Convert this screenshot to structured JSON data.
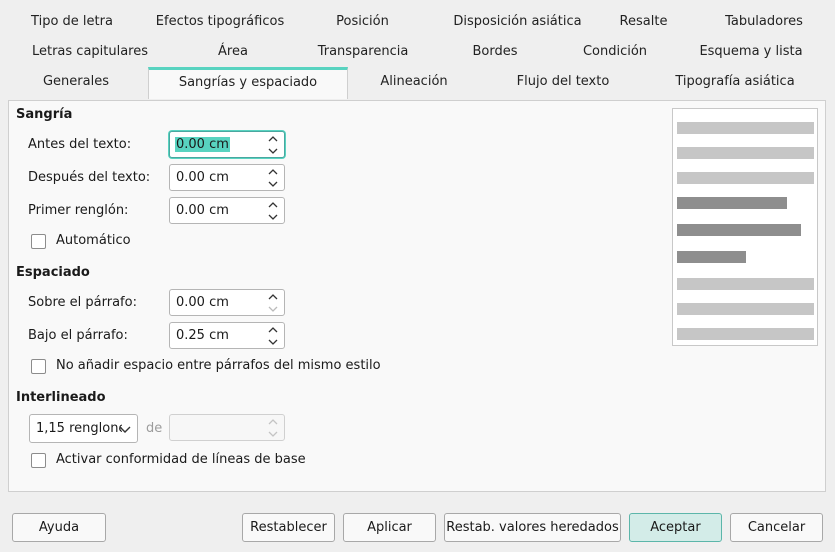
{
  "tabs": {
    "row1": [
      "Tipo de letra",
      "Efectos tipográficos",
      "Posición",
      "Disposición asiática",
      "Resalte",
      "Tabuladores"
    ],
    "row2": [
      "Letras capitulares",
      "Área",
      "Transparencia",
      "Bordes",
      "Condición",
      "Esquema y lista"
    ],
    "row3": [
      "Generales",
      "Sangrías y espaciado",
      "Alineación",
      "Flujo del texto",
      "Tipografía asiática"
    ]
  },
  "sangria": {
    "title": "Sangría",
    "antes_label": "Antes del texto:",
    "antes_value": "0.00 cm",
    "despues_label": "Después del texto:",
    "despues_value": "0.00 cm",
    "primer_label": "Primer renglón:",
    "primer_value": "0.00 cm",
    "auto_label": "Automático"
  },
  "espaciado": {
    "title": "Espaciado",
    "sobre_label": "Sobre el párrafo:",
    "sobre_value": "0.00 cm",
    "bajo_label": "Bajo el párrafo:",
    "bajo_value": "0.25 cm",
    "noadd_label": "No añadir espacio entre párrafos del mismo estilo"
  },
  "interlineado": {
    "title": "Interlineado",
    "select_value": "1,15 renglones",
    "de_label": "de",
    "de_value": "",
    "conform_label": "Activar conformidad de líneas de base"
  },
  "buttons": {
    "help": "Ayuda",
    "reset": "Restablecer",
    "apply": "Aplicar",
    "inherit": "Restab. valores heredados",
    "ok": "Aceptar",
    "cancel": "Cancelar"
  }
}
